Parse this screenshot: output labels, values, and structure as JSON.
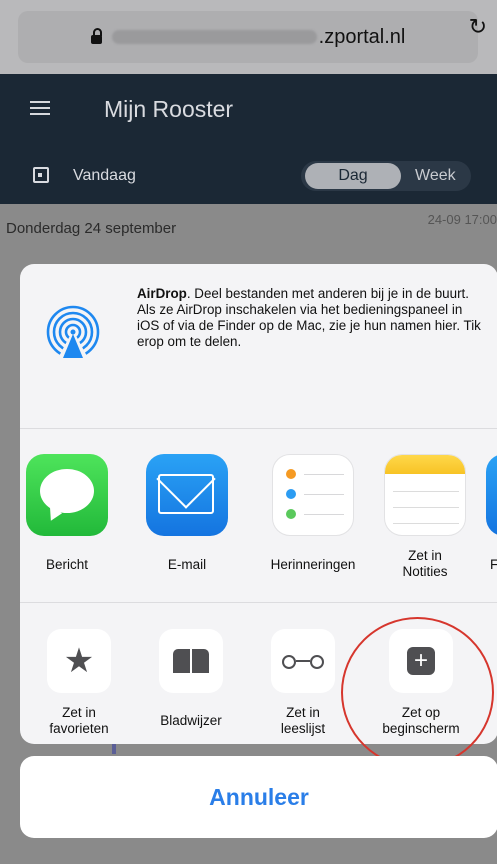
{
  "browser": {
    "url_domain": ".zportal.nl",
    "reload_icon": "↻"
  },
  "app": {
    "title": "Mijn Rooster",
    "today_label": "Vandaag",
    "view_day": "Dag",
    "view_week": "Week",
    "date_heading": "Donderdag 24 september",
    "date_time": "24-09 17:00"
  },
  "share_sheet": {
    "airdrop": {
      "title": "AirDrop",
      "description": ". Deel bestanden met anderen bij je in de buurt. Als ze AirDrop inschakelen via het bedieningspaneel in iOS of via de Finder op de Mac, zie je hun namen hier. Tik erop om te delen."
    },
    "apps": [
      {
        "label": "Bericht",
        "icon": "messages-icon"
      },
      {
        "label": "E-mail",
        "icon": "mail-icon"
      },
      {
        "label": "Herinneringen",
        "icon": "reminders-icon"
      },
      {
        "label": "Zet in Notities",
        "icon": "notes-icon"
      }
    ],
    "partial_app_label": "F",
    "actions": [
      {
        "label": "Zet in favorieten",
        "icon": "star-icon"
      },
      {
        "label": "Bladwijzer",
        "icon": "bookmark-icon"
      },
      {
        "label": "Zet in leeslijst",
        "icon": "reading-list-icon"
      },
      {
        "label": "Zet op beginscherm",
        "icon": "add-to-home-icon"
      }
    ]
  },
  "cancel_label": "Annuleer",
  "colors": {
    "header_bg": "#1b2835",
    "annotation_circle": "#d6362d",
    "link_blue": "#2a7ee8"
  }
}
